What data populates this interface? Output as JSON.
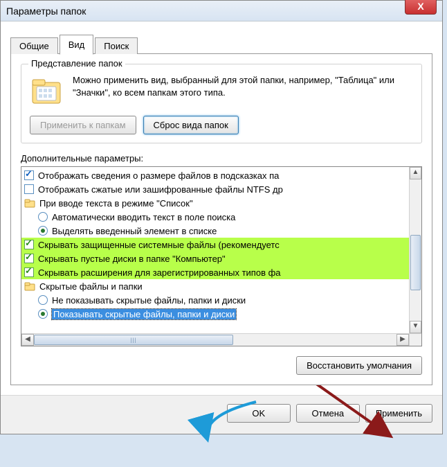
{
  "window": {
    "title": "Параметры папок",
    "close": "X"
  },
  "tabs": {
    "general": "Общие",
    "view": "Вид",
    "search": "Поиск"
  },
  "folderViews": {
    "groupTitle": "Представление папок",
    "description": "Можно применить вид, выбранный для этой папки, например, \"Таблица\" или \"Значки\", ко всем папкам этого типа.",
    "applyBtn": "Применить к папкам",
    "resetBtn": "Сброс вида папок"
  },
  "advanced": {
    "label": "Дополнительные параметры:",
    "items": {
      "sizeInfo": "Отображать сведения о размере файлов в подсказках па",
      "compressed": "Отображать сжатые или зашифрованные файлы NTFS др",
      "typingGroup": "При вводе текста в режиме \"Список\"",
      "typingAuto": "Автоматически вводить текст в поле поиска",
      "typingSelect": "Выделять введенный элемент в списке",
      "hideProtected": "Скрывать защищенные системные файлы (рекомендуетс",
      "hideEmptyDrives": "Скрывать пустые диски в папке \"Компьютер\"",
      "hideExtensions": "Скрывать расширения для зарегистрированных типов фа",
      "hiddenGroup": "Скрытые файлы и папки",
      "dontShowHidden": "Не показывать скрытые файлы, папки и диски",
      "showHidden": "Показывать скрытые файлы, папки и диски"
    }
  },
  "restoreDefaults": "Восстановить умолчания",
  "bottom": {
    "ok": "OK",
    "cancel": "Отмена",
    "apply": "Применить"
  }
}
